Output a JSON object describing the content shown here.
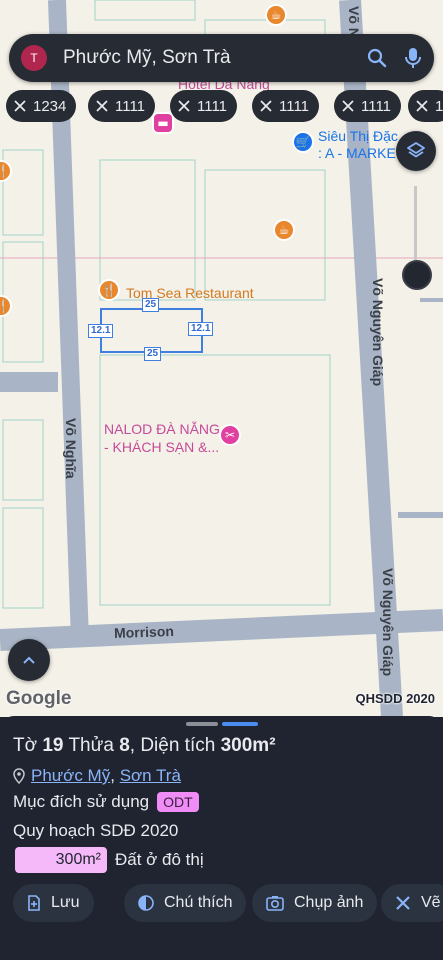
{
  "search": {
    "avatar_letter": "T",
    "query": "Phước Mỹ, Sơn Trà",
    "icons": [
      "search-icon",
      "mic-icon"
    ]
  },
  "chips": [
    {
      "label": "1234"
    },
    {
      "label": "1111"
    },
    {
      "label": "1111"
    },
    {
      "label": "1111"
    },
    {
      "label": "1111"
    },
    {
      "label": "1"
    }
  ],
  "map": {
    "pois": {
      "hotel_top": "Hotel Da Nang",
      "supermarket_line1": "Siêu Thị Đặc",
      "supermarket_line2": ": A - MARKET",
      "restaurant": "Tom Sea Restaurant",
      "nalod_line1": "NALOD ĐÀ NẴNG",
      "nalod_line2": "- KHÁCH SẠN &..."
    },
    "roads": {
      "vo_nguyen_giap_top": "Võ Nguyên Giáp",
      "vo_nguyen_giap_bottom": "Võ Nguyên Giáp",
      "vo_nghia": "Võ Nghĩa",
      "morrison": "Morrison",
      "top_road": "Võ N"
    },
    "plot_dims": {
      "top": "25",
      "bottom": "25",
      "left": "12.1",
      "right": "12.1"
    },
    "google_logo": "Google",
    "layer_name": "QHSDD 2020",
    "colors": {
      "plot_outline": "#3f7fe0",
      "road": "#a9b5c6"
    }
  },
  "sheet": {
    "title": {
      "prefix": "Tờ",
      "sheet_no": "19",
      "parcel_label": "Thửa",
      "parcel_no": "8",
      "area_label": ", Diện tích",
      "area_value": "300m²"
    },
    "location": {
      "ward": "Phước Mỹ",
      "sep": ",",
      "district": "Sơn Trà"
    },
    "purpose": {
      "label": "Mục đích sử dụng",
      "code": "ODT"
    },
    "plan_title": "Quy hoạch SDĐ 2020",
    "plan_area": "300m²",
    "plan_desc": "Đất ở đô thị",
    "actions": [
      {
        "label": "Lưu",
        "icon": "save-icon"
      },
      {
        "label": "Chú thích",
        "icon": "contrast-icon"
      },
      {
        "label": "Chụp ảnh",
        "icon": "camera-icon"
      },
      {
        "label": "Vẽ",
        "icon": "draw-icon"
      }
    ]
  }
}
